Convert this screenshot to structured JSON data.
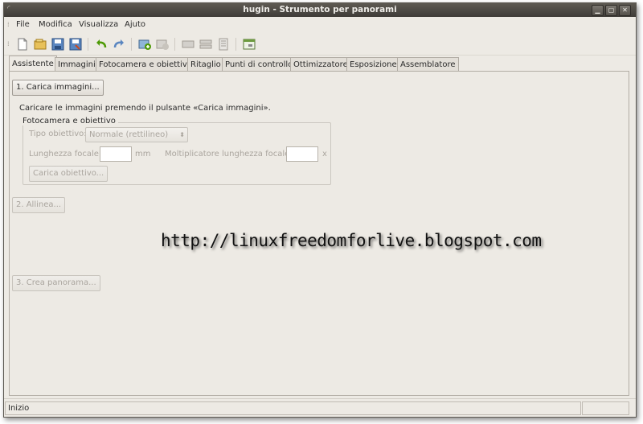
{
  "window": {
    "title": "hugin - Strumento per panorami"
  },
  "menubar": {
    "items": [
      "File",
      "Modifica",
      "Visualizza",
      "Ajuto"
    ]
  },
  "toolbar": {
    "icons": [
      "new-project-icon",
      "open-project-icon",
      "save-project-icon",
      "save-as-icon",
      "undo-icon",
      "redo-icon",
      "add-images-icon",
      "remove-images-icon",
      "optimize-icon",
      "align-icon",
      "assemble-icon",
      "preview-icon"
    ]
  },
  "tabs": [
    "Assistente",
    "Immagini",
    "Fotocamera e obiettivo",
    "Ritaglio",
    "Punti di controllo",
    "Ottimizzatore",
    "Esposizione",
    "Assemblatore"
  ],
  "assistant": {
    "load_button": "1. Carica immagini...",
    "instruction": "Caricare le immagini premendo il pulsante «Carica immagini».",
    "camera_group": {
      "title": "Fotocamera e obiettivo",
      "lens_type_label": "Tipo obiettivo:",
      "lens_type_value": "Normale (rettilineo)",
      "focal_length_label": "Lunghezza focale:",
      "focal_length_value": "",
      "focal_length_unit": "mm",
      "crop_factor_label": "Moltiplicatore lunghezza focale:",
      "crop_factor_value": "",
      "crop_factor_unit": "x",
      "load_lens_button": "Carica obiettivo..."
    },
    "align_button": "2. Allinea...",
    "create_button": "3. Crea panorama..."
  },
  "watermark": "http://linuxfreedomforlive.blogspot.com",
  "statusbar": {
    "text": "Inizio"
  }
}
